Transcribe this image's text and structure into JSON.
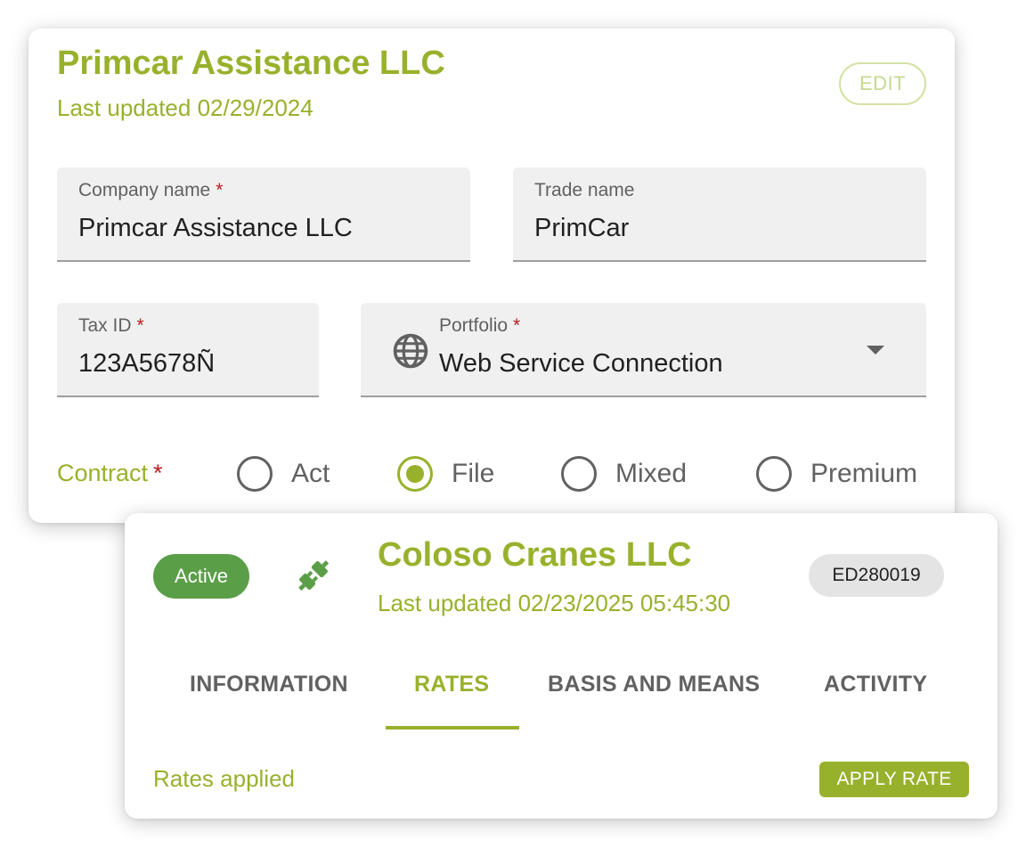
{
  "company_card": {
    "title": "Primcar Assistance LLC",
    "last_updated": "Last updated 02/29/2024",
    "edit_label": "EDIT",
    "fields": {
      "company_name": {
        "label": "Company name",
        "required_mark": "*",
        "value": "Primcar Assistance LLC"
      },
      "trade_name": {
        "label": "Trade name",
        "value": "PrimCar"
      },
      "tax_id": {
        "label": "Tax ID",
        "required_mark": "*",
        "value": "123A5678Ñ"
      },
      "portfolio": {
        "label": "Portfolio",
        "required_mark": "*",
        "value": "Web Service Connection",
        "icon": "globe-icon"
      }
    },
    "contract": {
      "label": "Contract",
      "required_mark": "*",
      "options": [
        "Act",
        "File",
        "Mixed",
        "Premium"
      ],
      "selected": "File"
    }
  },
  "client_card": {
    "status": "Active",
    "status_color": "#5b9e48",
    "icon": "plug-connection-icon",
    "title": "Coloso Cranes LLC",
    "last_updated": "Last updated 02/23/2025 05:45:30",
    "code": "ED280019",
    "tabs": [
      "INFORMATION",
      "RATES",
      "BASIS AND MEANS",
      "ACTIVITY"
    ],
    "active_tab": "RATES",
    "rates_label": "Rates applied",
    "apply_rate_label": "APPLY RATE"
  },
  "colors": {
    "accent": "#98b12c",
    "required": "#b71c1c",
    "field_bg": "#f0f0f0"
  }
}
